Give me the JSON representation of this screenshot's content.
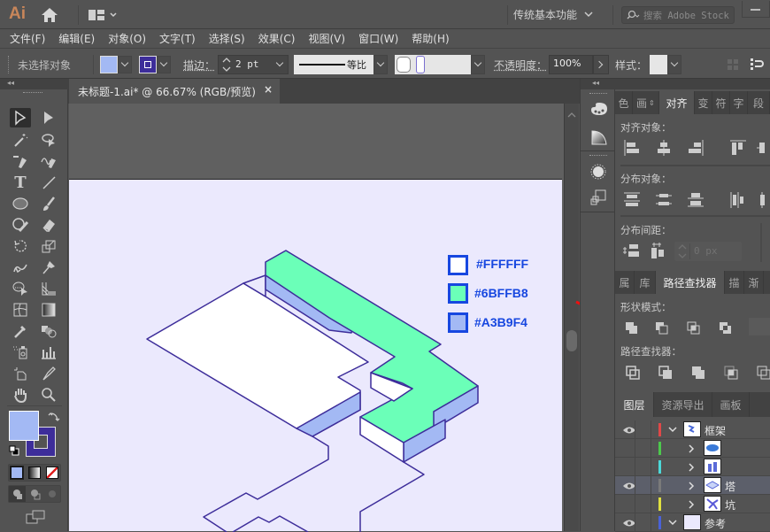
{
  "app": {
    "logo": "Ai",
    "workspace": "传统基本功能",
    "search_placeholder": "搜索 Adobe Stock"
  },
  "menu": [
    "文件(F)",
    "编辑(E)",
    "对象(O)",
    "文字(T)",
    "选择(S)",
    "效果(C)",
    "视图(V)",
    "窗口(W)",
    "帮助(H)"
  ],
  "control": {
    "selection": "未选择对象",
    "fill_color": "#A3B9F4",
    "stroke_color": "#3D2D9A",
    "stroke_label": "描边：",
    "stroke_weight": "2 pt",
    "profile_label": "等比",
    "opacity_label": "不透明度：",
    "opacity_value": "100%",
    "style_label": "样式："
  },
  "document": {
    "tab_title": "未标题-1.ai* @ 66.67% (RGB/预览)",
    "close": "×"
  },
  "artboard": {
    "swatches": [
      {
        "hex": "#FFFFFF",
        "label": "#FFFFFF"
      },
      {
        "hex": "#6BFFB8",
        "label": "#6BFFB8"
      },
      {
        "hex": "#A3B9F4",
        "label": "#A3B9F4"
      }
    ],
    "stroke_color": "#3D2D9A",
    "background": "#EBE9FD"
  },
  "tools": {
    "fill": "#A3B9F4",
    "stroke": "#3D2D9A"
  },
  "align_panel": {
    "tabs": [
      "色",
      "画",
      "对齐",
      "变",
      "符",
      "字",
      "段"
    ],
    "active_tab": "对齐",
    "align_objects": "对齐对象：",
    "distribute_objects": "分布对象：",
    "distribute_spacing": "分布间距：",
    "spacing_value": "0 px"
  },
  "pathfinder_panel": {
    "tabs": [
      "属",
      "库",
      "路径查找器",
      "描",
      "渐"
    ],
    "active_tab": "路径查找器",
    "shape_modes": "形状模式：",
    "pathfinders": "路径查找器："
  },
  "layers_panel": {
    "tabs": [
      "图层",
      "资源导出",
      "画板"
    ],
    "active_tab": "图层",
    "rows": [
      {
        "name": "框架",
        "color": "#E04848",
        "visible": true,
        "expanded": true,
        "level": 0
      },
      {
        "name": "",
        "color": "#4CC84C",
        "visible": false,
        "expanded": false,
        "level": 1
      },
      {
        "name": "",
        "color": "#4CD8D8",
        "visible": false,
        "expanded": false,
        "level": 1
      },
      {
        "name": "塔",
        "color": "#7A7A7A",
        "visible": true,
        "expanded": false,
        "level": 1
      },
      {
        "name": "坑",
        "color": "#E0E040",
        "visible": false,
        "expanded": false,
        "level": 1
      },
      {
        "name": "参考",
        "color": "#4A62D8",
        "visible": true,
        "expanded": true,
        "level": 0
      }
    ]
  }
}
